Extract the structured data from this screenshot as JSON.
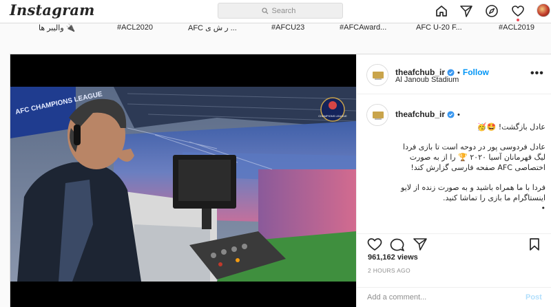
{
  "app": {
    "name": "Instagram"
  },
  "search": {
    "placeholder": "Search"
  },
  "nav": {
    "icons": [
      "home-icon",
      "direct-icon",
      "explore-icon",
      "activity-heart-icon",
      "profile-avatar"
    ]
  },
  "hashtags": [
    "واليبر ها 🔌",
    "#ACL2020",
    "AFC ر ش ی ...",
    "#AFCU23",
    "#AFCAward...",
    "AFC U-20 F...",
    "#ACL2019"
  ],
  "post": {
    "username": "theafchub_ir",
    "follow_label": "Follow",
    "location": "Al Janoub Stadium",
    "more_label": "•••",
    "caption_lines": [
      "عادل بازگشت! 🤩🥳",
      "عادل فردوسی پور در دوحه است تا بازی فردا لیگ قهرمانان آسیا ۲۰۲۰ 🏆 را از به صورت اختصاصی AFC صفحه فارسی گزارش کند!",
      "فردا با ما همراه باشید و به صورت زنده از لایو اینستاگرام ما بازی را تماشا کنید.",
      "•"
    ],
    "views": "961,162 views",
    "time": "2 HOURS AGO",
    "comment_placeholder": "Add a comment...",
    "post_label": "Post",
    "logo_text": "CHAMPIONS LEAGUE"
  },
  "colors": {
    "link": "#0095f6",
    "verified": "#3897f0",
    "muted": "#8e8e8e",
    "border": "#dbdbdb"
  }
}
